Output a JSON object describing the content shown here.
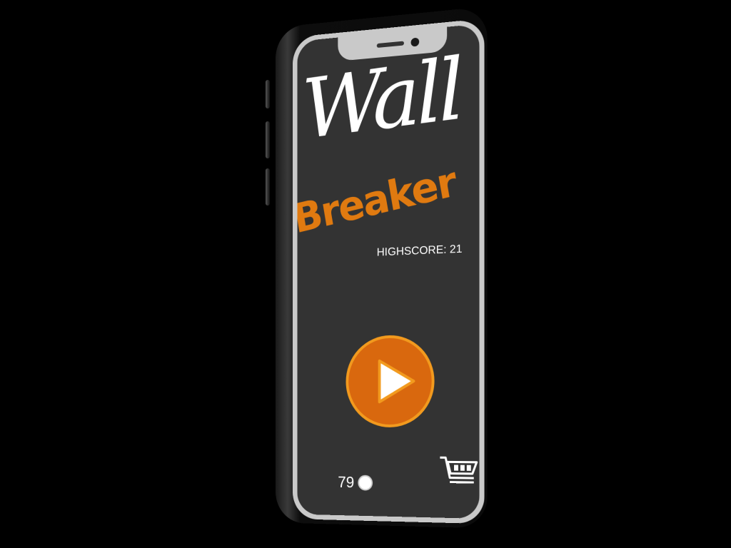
{
  "game": {
    "title_line1": "Wall",
    "title_line2": "Breaker",
    "highscore_label": "HIGHSCORE: 21",
    "coins": "79"
  },
  "icons": {
    "play": "play-icon",
    "coin": "coin-icon",
    "shop": "cart-icon"
  },
  "colors": {
    "background": "#000000",
    "screen": "#333333",
    "accent": "#e07a10",
    "play_fill": "#d9680e",
    "play_ring": "#f29a1e",
    "text": "#ffffff"
  }
}
